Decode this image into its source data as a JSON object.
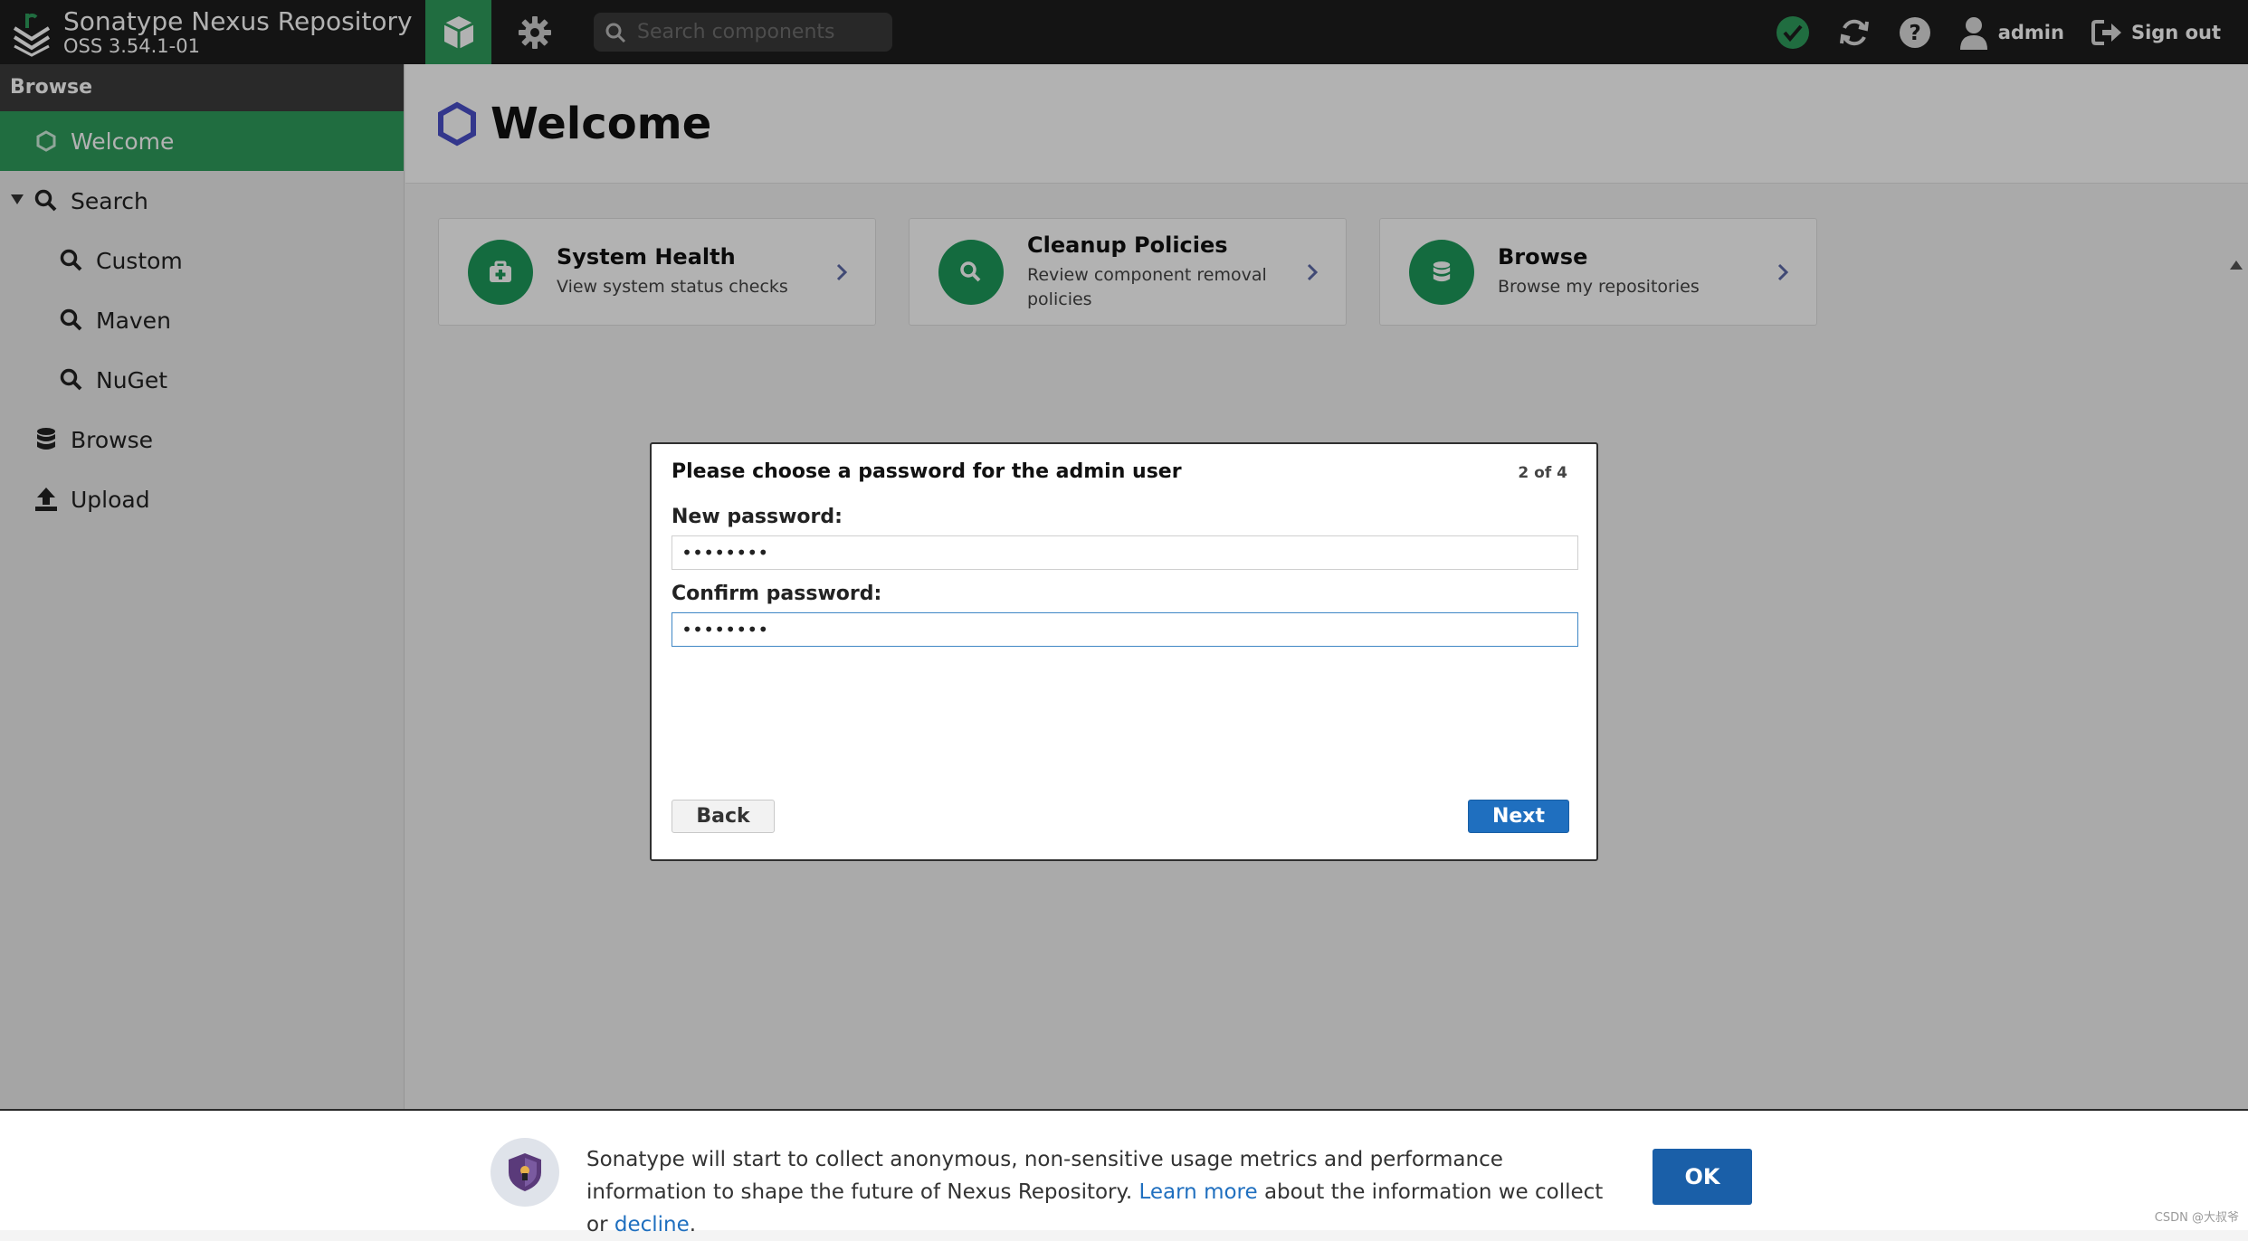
{
  "header": {
    "app_title": "Sonatype Nexus Repository",
    "version": "OSS 3.54.1-01",
    "search_placeholder": "Search components",
    "user_label": "admin",
    "signout_label": "Sign out"
  },
  "sidebar": {
    "section_title": "Browse",
    "items": [
      {
        "label": "Welcome"
      },
      {
        "label": "Search"
      },
      {
        "label": "Custom"
      },
      {
        "label": "Maven"
      },
      {
        "label": "NuGet"
      },
      {
        "label": "Browse"
      },
      {
        "label": "Upload"
      }
    ]
  },
  "main": {
    "title": "Welcome",
    "cards": [
      {
        "title": "System Health",
        "subtitle": "View system status checks"
      },
      {
        "title": "Cleanup Policies",
        "subtitle": "Review component removal policies"
      },
      {
        "title": "Browse",
        "subtitle": "Browse my repositories"
      }
    ]
  },
  "dialog": {
    "title": "Please choose a password for the admin user",
    "step": "2 of 4",
    "new_password_label": "New password:",
    "new_password_value": "••••••••",
    "confirm_password_label": "Confirm password:",
    "confirm_password_value": "••••••••",
    "back_label": "Back",
    "next_label": "Next"
  },
  "banner": {
    "text_before": "Sonatype will start to collect anonymous, non-sensitive usage metrics and performance information to shape the future of Nexus Repository.",
    "learn_more": "Learn more",
    "text_middle": "about the information we collect or",
    "decline": "decline",
    "text_end": ".",
    "ok_label": "OK"
  },
  "watermark": "CSDN @大叔爷",
  "colors": {
    "accent_green": "#2e9c5c",
    "primary_blue": "#1f6fbf",
    "header_bg": "#1e1e1e"
  }
}
